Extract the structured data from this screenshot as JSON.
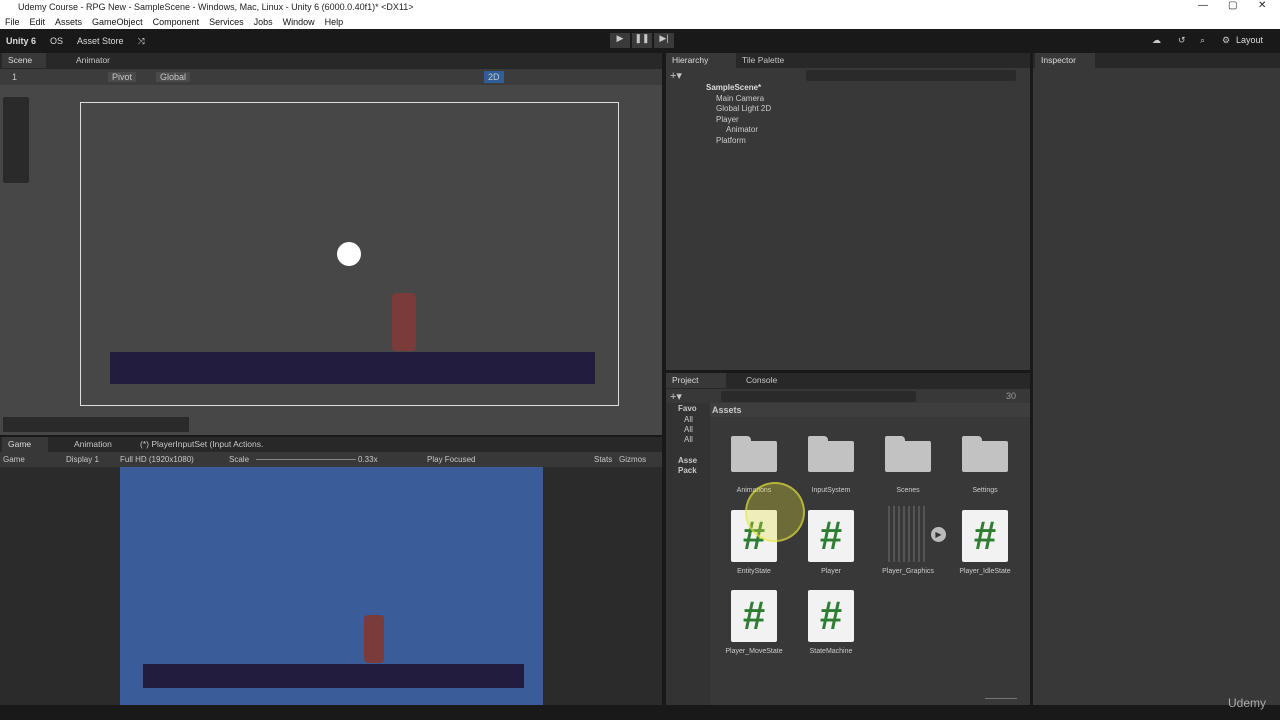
{
  "window": {
    "title": "Udemy Course - RPG New - SampleScene - Windows, Mac, Linux - Unity 6 (6000.0.40f1)* <DX11>"
  },
  "menu": [
    "File",
    "Edit",
    "Assets",
    "GameObject",
    "Component",
    "Services",
    "Jobs",
    "Window",
    "Help"
  ],
  "toolbar": {
    "account": "Unity 6",
    "os": "OS",
    "asset_store": "Asset Store",
    "layout": "Layout"
  },
  "scene": {
    "tabs": [
      "Scene",
      "Animator"
    ],
    "pivot": "Pivot",
    "global": "Global",
    "layer": "1",
    "mode_2d": "2D"
  },
  "game": {
    "tabs": [
      "Game",
      "Animation",
      "(*) PlayerInputSet (Input Actions."
    ],
    "view": "Game",
    "display": "Display 1",
    "resolution": "Full HD (1920x1080)",
    "scale_label": "Scale",
    "scale_value": "0.33x",
    "play_mode": "Play Focused",
    "stats": "Stats",
    "gizmos": "Gizmos"
  },
  "hierarchy": {
    "tabs": [
      "Hierarchy",
      "Tile Palette"
    ],
    "items": [
      {
        "label": "SampleScene*",
        "depth": 0
      },
      {
        "label": "Main Camera",
        "depth": 1
      },
      {
        "label": "Global Light 2D",
        "depth": 1
      },
      {
        "label": "Player",
        "depth": 1
      },
      {
        "label": "Animator",
        "depth": 2
      },
      {
        "label": "Platform",
        "depth": 1
      }
    ]
  },
  "inspector": {
    "tab": "Inspector"
  },
  "project": {
    "tabs": [
      "Project",
      "Console"
    ],
    "count": "30",
    "breadcrumb": "Assets",
    "tree": [
      "Favo",
      "All",
      "All",
      "All",
      "Asse",
      "Pack"
    ],
    "assets": [
      {
        "name": "Animations",
        "type": "folder"
      },
      {
        "name": "InputSystem",
        "type": "folder"
      },
      {
        "name": "Scenes",
        "type": "folder"
      },
      {
        "name": "Settings",
        "type": "folder"
      },
      {
        "name": "EntityState",
        "type": "script"
      },
      {
        "name": "Player",
        "type": "script"
      },
      {
        "name": "Player_Graphics",
        "type": "sprite"
      },
      {
        "name": "Player_IdleState",
        "type": "script"
      },
      {
        "name": "Player_MoveState",
        "type": "script"
      },
      {
        "name": "StateMachine",
        "type": "script"
      }
    ]
  },
  "watermark": "Udemy"
}
